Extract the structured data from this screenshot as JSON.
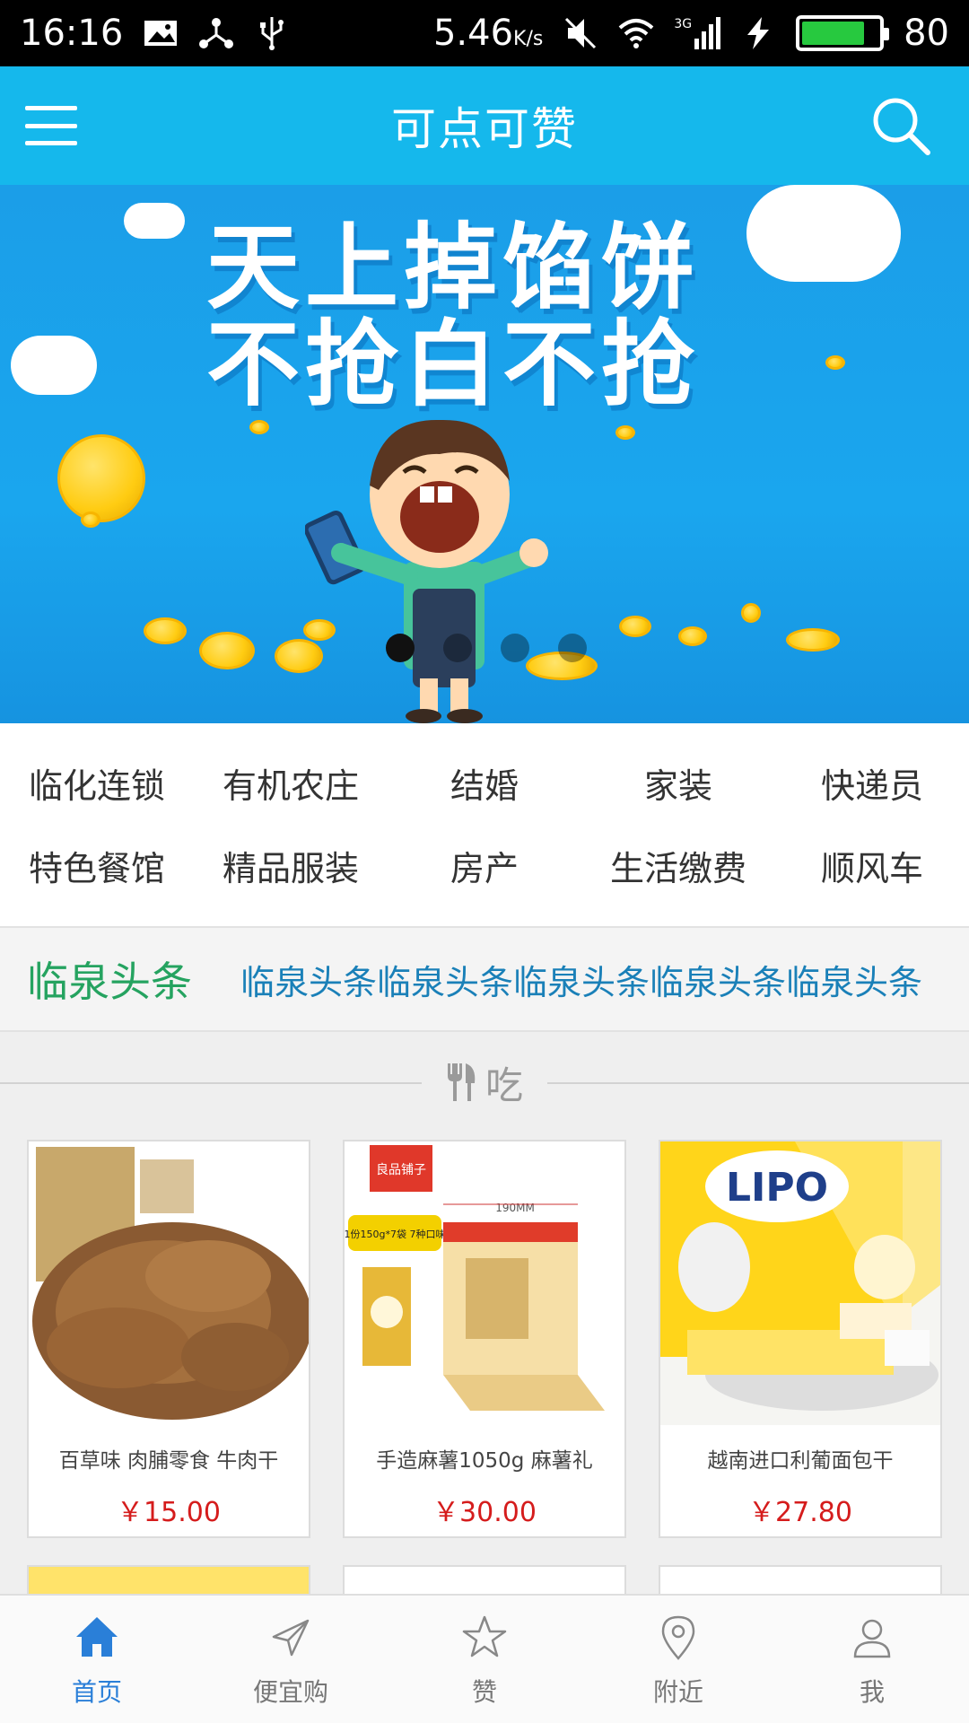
{
  "status_bar": {
    "time": "16:16",
    "net_speed": "5.46",
    "net_unit": "K/s",
    "network": "3G",
    "battery": "80",
    "battery_level": 0.8
  },
  "app_bar": {
    "title": "可点可赞",
    "menu_icon": "menu-icon",
    "search_icon": "search-icon"
  },
  "banner": {
    "line1": "天上掉馅饼",
    "line2": "不抢白不抢",
    "slide_count": 4,
    "active_slide": 1
  },
  "categories": [
    {
      "label": "临化连锁"
    },
    {
      "label": "有机农庄"
    },
    {
      "label": "结婚"
    },
    {
      "label": "家装"
    },
    {
      "label": "快递员"
    },
    {
      "label": "特色餐馆"
    },
    {
      "label": "精品服装"
    },
    {
      "label": "房产"
    },
    {
      "label": "生活缴费"
    },
    {
      "label": "顺风车"
    }
  ],
  "headline": {
    "label": "临泉头条",
    "text": "临泉头条临泉头条临泉头条临泉头条临泉头条"
  },
  "section": {
    "icon": "fork-knife-icon",
    "title": "吃"
  },
  "products": [
    {
      "name": "百草味 肉脯零食 牛肉干",
      "price": "￥15.00"
    },
    {
      "name": "手造麻薯1050g 麻薯礼",
      "price": "￥30.00"
    },
    {
      "name": "越南进口利葡面包干",
      "price": "￥27.80"
    }
  ],
  "product_image_text": {
    "p2_brand": "良品铺子",
    "p2_promo": "1份150g*7袋 7种口味",
    "p2_dim": "190MM",
    "p3_brand": "LIPO"
  },
  "tabs": [
    {
      "label": "首页",
      "icon": "home-icon",
      "active": true
    },
    {
      "label": "便宜购",
      "icon": "paper-plane-icon",
      "active": false
    },
    {
      "label": "赞",
      "icon": "star-icon",
      "active": false
    },
    {
      "label": "附近",
      "icon": "location-pin-icon",
      "active": false
    },
    {
      "label": "我",
      "icon": "user-icon",
      "active": false
    }
  ],
  "colors": {
    "primary": "#15b8ec",
    "headline_green": "#25a360",
    "headline_blue": "#1a80b8",
    "price_red": "#d51c1c",
    "tab_active": "#2a7fd8"
  }
}
